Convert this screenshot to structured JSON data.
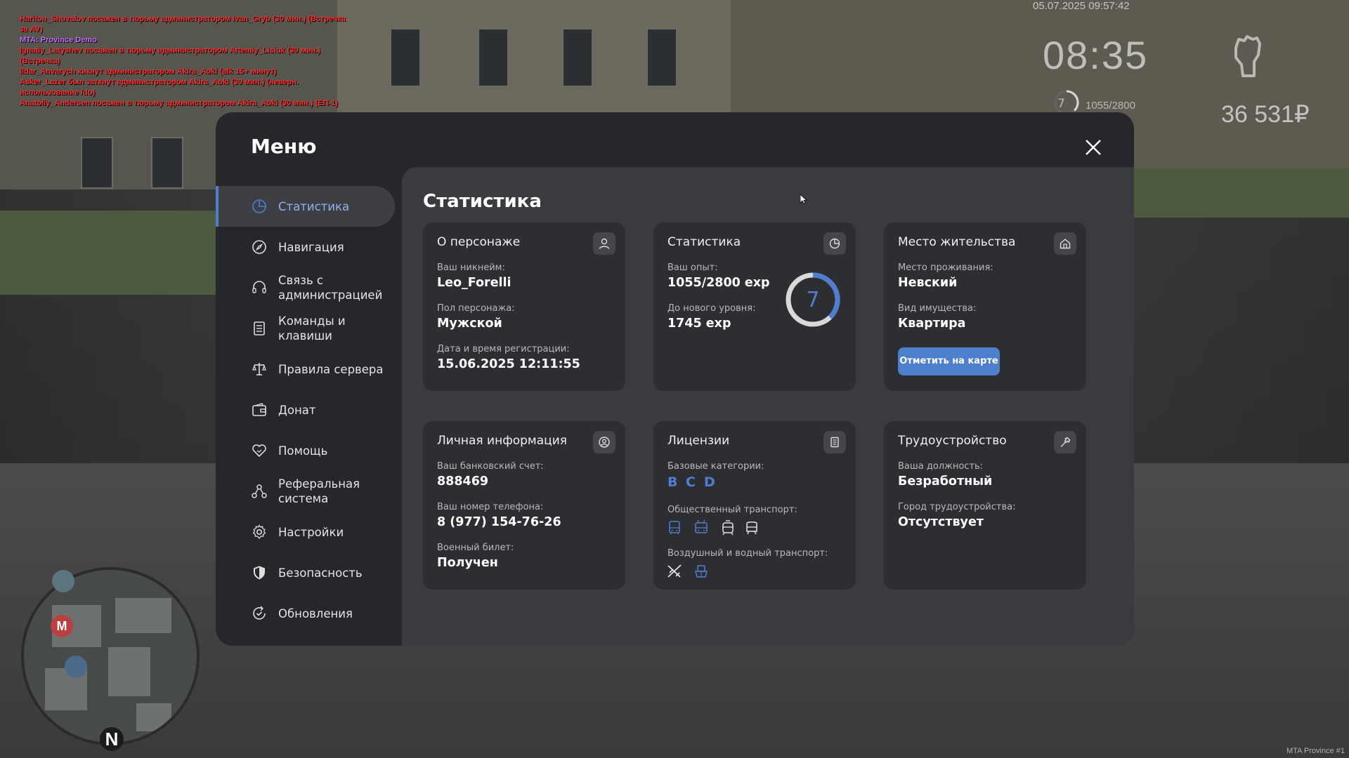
{
  "chat_log": [
    {
      "text": "Hariton_Shuvalov посажен в тюрьму администратором Ivan_Gryb (30 мин.) (Встречка за AV)",
      "type": "admin"
    },
    {
      "text": "MTA: Province Demo",
      "type": "mta"
    },
    {
      "text": "Ignatiy_Latyshev посажен в тюрьму администратором Artemiy_Lisiuk (30 мин.) (Встречка)",
      "type": "admin"
    },
    {
      "text": "Ildar_Anvarych кикнут администратором Akira_Aoki (afk 15+ минут)",
      "type": "admin"
    },
    {
      "text": "Asker_Lazer был заткнут администратором Akira_Aoki (30 мин.) (неверн. использование /do)",
      "type": "admin"
    },
    {
      "text": "Anatoliy_Andersen посажен в тюрьму администратором Akira_Aoki (30 мин.) (ЕП-1)",
      "type": "admin"
    }
  ],
  "hud": {
    "datetime": "05.07.2025 09:57:42",
    "clock": "08:35",
    "level": "7",
    "exp": "1055/2800",
    "money": "36 531₽",
    "level_ring_fraction": 0.377
  },
  "minimap": {
    "north": "N",
    "marker_metro": "M"
  },
  "watermark": "MTA Province #1",
  "menu": {
    "title": "Меню",
    "nav": [
      {
        "label": "Статистика",
        "icon": "pie-chart-icon",
        "active": true
      },
      {
        "label": "Навигация",
        "icon": "compass-icon"
      },
      {
        "label": "Связь с\nадминистрацией",
        "icon": "headset-icon"
      },
      {
        "label": "Команды и\nклавиши",
        "icon": "document-list-icon"
      },
      {
        "label": "Правила сервера",
        "icon": "scales-icon"
      },
      {
        "label": "Донат",
        "icon": "wallet-icon"
      },
      {
        "label": "Помощь",
        "icon": "heart-hand-icon"
      },
      {
        "label": "Реферальная\nсистема",
        "icon": "referral-icon"
      },
      {
        "label": "Настройки",
        "icon": "gear-icon"
      },
      {
        "label": "Безопасность",
        "icon": "shield-icon"
      },
      {
        "label": "Обновления",
        "icon": "refresh-check-icon"
      }
    ]
  },
  "content": {
    "title": "Статистика",
    "character": {
      "title": "О персонаже",
      "nickname_label": "Ваш никнейм:",
      "nickname": "Leo_Forelli",
      "gender_label": "Пол персонажа:",
      "gender": "Мужской",
      "reg_label": "Дата и время регистрации:",
      "reg": "15.06.2025 12:11:55"
    },
    "stats": {
      "title": "Статистика",
      "exp_label": "Ваш опыт:",
      "exp": "1055/2800 exp",
      "next_label": "До нового уровня:",
      "next": "1745 exp",
      "level": "7",
      "progress_fraction": 0.377
    },
    "residence": {
      "title": "Место жительства",
      "place_label": "Место проживания:",
      "place": "Невский",
      "property_label": "Вид имущества:",
      "property": "Квартира",
      "map_button": "Отметить на карте"
    },
    "personal": {
      "title": "Личная информация",
      "bank_label": "Ваш банковский счет:",
      "bank": "888469",
      "phone_label": "Ваш номер телефона:",
      "phone": "8 (977) 154-76-26",
      "military_label": "Военный билет:",
      "military": "Получен"
    },
    "licenses": {
      "title": "Лицензии",
      "base_label": "Базовые категории:",
      "categories": [
        "B",
        "C",
        "D"
      ],
      "public_label": "Общественный транспорт:",
      "public_icons": [
        "bus-icon",
        "trolleybus-icon",
        "tram-icon",
        "metro-icon"
      ],
      "air_label": "Воздушный и водный транспорт:",
      "air_icons": [
        "plane-icon",
        "boat-icon"
      ]
    },
    "employment": {
      "title": "Трудоустройство",
      "position_label": "Ваша должность:",
      "position": "Безработный",
      "city_label": "Город трудоустройства:",
      "city": "Отсутствует"
    }
  },
  "colors": {
    "accent": "#4f7ed1",
    "panel": "#26272a",
    "content": "#3a3b3f",
    "card": "#2d2e32"
  }
}
